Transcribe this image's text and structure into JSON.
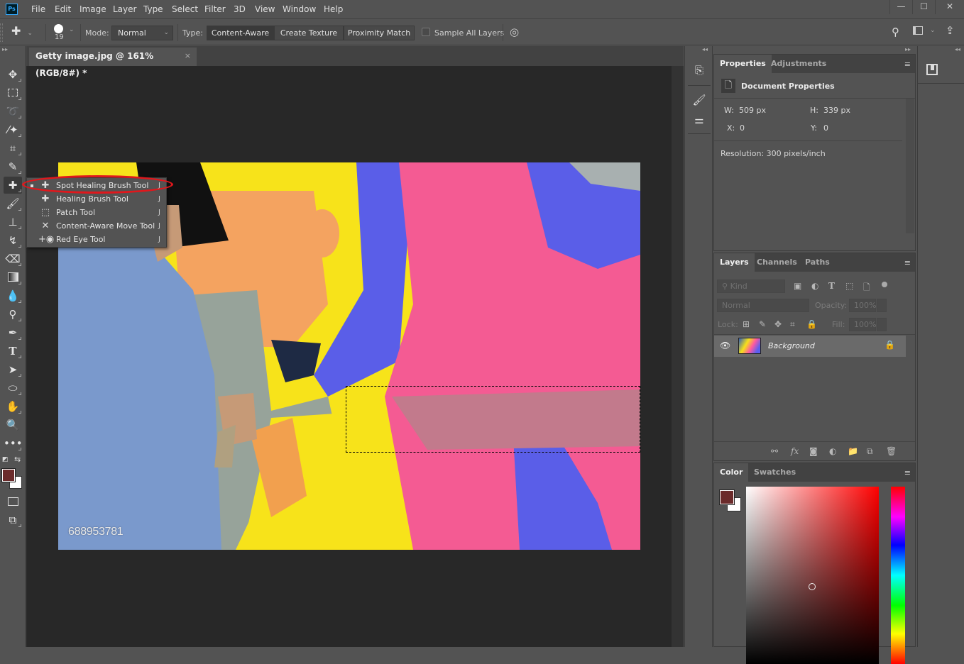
{
  "app": {
    "logo": "Ps",
    "accent": "#31a8ff"
  },
  "menubar": {
    "items": [
      "File",
      "Edit",
      "Image",
      "Layer",
      "Type",
      "Select",
      "Filter",
      "3D",
      "View",
      "Window",
      "Help"
    ],
    "window_controls": {
      "minimize": "—",
      "maximize": "☐",
      "close": "✕"
    }
  },
  "options_bar": {
    "tool_icon": "spot-healing-brush-icon",
    "brush_size": "19",
    "mode_label": "Mode:",
    "mode_value": "Normal",
    "type_label": "Type:",
    "type_options": [
      "Content-Aware",
      "Create Texture",
      "Proximity Match"
    ],
    "type_selected": "Content-Aware",
    "sample_all_layers_label": "Sample All Layers",
    "sample_all_layers_checked": false
  },
  "document": {
    "tab_title": "Getty image.jpg @ 161% (RGB/8#) *",
    "close_glyph": "×",
    "watermark": "688953781"
  },
  "tool_flyout": {
    "items": [
      {
        "label": "Spot Healing Brush Tool",
        "shortcut": "J",
        "icon": "spot-healing-brush-icon",
        "active": true
      },
      {
        "label": "Healing Brush Tool",
        "shortcut": "J",
        "icon": "healing-brush-icon",
        "active": false
      },
      {
        "label": "Patch Tool",
        "shortcut": "J",
        "icon": "patch-icon",
        "active": false
      },
      {
        "label": "Content-Aware Move Tool",
        "shortcut": "J",
        "icon": "content-aware-move-icon",
        "active": false
      },
      {
        "label": "Red Eye Tool",
        "shortcut": "J",
        "icon": "red-eye-icon",
        "active": false
      }
    ],
    "highlight_color": "#e0171c"
  },
  "properties_panel": {
    "tabs": [
      "Properties",
      "Adjustments"
    ],
    "active_tab": "Properties",
    "section_title": "Document Properties",
    "w_label": "W:",
    "w_value": "509 px",
    "h_label": "H:",
    "h_value": "339 px",
    "x_label": "X:",
    "x_value": "0",
    "y_label": "Y:",
    "y_value": "0",
    "resolution": "Resolution: 300 pixels/inch"
  },
  "layers_panel": {
    "tabs": [
      "Layers",
      "Channels",
      "Paths"
    ],
    "active_tab": "Layers",
    "filter_placeholder": "Kind",
    "blend_mode": "Normal",
    "opacity_label": "Opacity:",
    "opacity_value": "100%",
    "lock_label": "Lock:",
    "fill_label": "Fill:",
    "fill_value": "100%",
    "layers": [
      {
        "name": "Background",
        "visible": true,
        "locked": true
      }
    ]
  },
  "color_panel": {
    "tabs": [
      "Color",
      "Swatches"
    ],
    "active_tab": "Color",
    "foreground": "#6b2b2b",
    "background": "#ffffff",
    "hue_base": "#ff0000"
  }
}
